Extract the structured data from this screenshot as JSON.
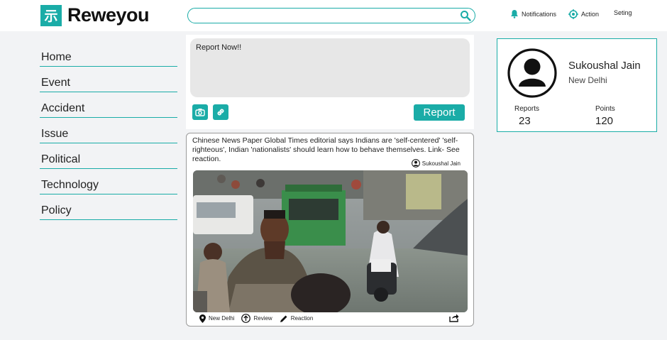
{
  "brand": {
    "logo_glyph": "示",
    "name": "Reweyou",
    "accent": "#1aaca7"
  },
  "search": {
    "placeholder": "",
    "icon": "search-icon"
  },
  "topnav": {
    "notifications": "Notifications",
    "action": "Action",
    "setting": "Seting"
  },
  "sidebar": {
    "items": [
      {
        "label": "Home"
      },
      {
        "label": "Event"
      },
      {
        "label": "Accident"
      },
      {
        "label": "Issue"
      },
      {
        "label": "Political"
      },
      {
        "label": "Technology"
      },
      {
        "label": "Policy"
      }
    ]
  },
  "composer": {
    "placeholder": "Report Now!!",
    "report_label": "Report",
    "icons": [
      "camera-icon",
      "link-icon"
    ]
  },
  "post": {
    "text": "Chinese News Paper Global Times editorial says Indians are 'self-centered' 'self-righteous', Indian 'nationalists' should learn how to behave themselves. Link- See reaction.",
    "author": "Sukoushal Jain",
    "location": "New Delhi",
    "review_label": "Review",
    "reaction_label": "Reaction"
  },
  "profile": {
    "name": "Sukoushal Jain",
    "city": "New Delhi",
    "reports_label": "Reports",
    "reports_value": "23",
    "points_label": "Points",
    "points_value": "120"
  }
}
